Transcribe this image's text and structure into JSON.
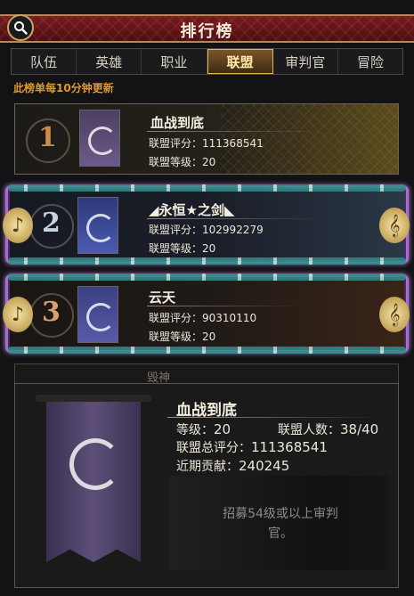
{
  "header": {
    "title": "排行榜",
    "search_icon": "search-icon"
  },
  "tabs": [
    {
      "label": "队伍",
      "active": false
    },
    {
      "label": "英雄",
      "active": false
    },
    {
      "label": "职业",
      "active": false
    },
    {
      "label": "联盟",
      "active": true
    },
    {
      "label": "审判官",
      "active": false
    },
    {
      "label": "冒险",
      "active": false
    }
  ],
  "notice": "此榜单每10分钟更新",
  "rankings": [
    {
      "rank": "1",
      "name": "血战到底",
      "score_label": "联盟评分：",
      "score": "111368541",
      "level_label": "联盟等级：",
      "level": "20"
    },
    {
      "rank": "2",
      "name": "◢永恒★之剑◣",
      "score_label": "联盟评分：",
      "score": "102992279",
      "level_label": "联盟等级：",
      "level": "20"
    },
    {
      "rank": "3",
      "name": "云天",
      "score_label": "联盟评分：",
      "score": "90310110",
      "level_label": "联盟等级：",
      "level": "20"
    },
    {
      "name": "毁神"
    }
  ],
  "detail": {
    "name": "血战到底",
    "level_label": "等级：",
    "level": "20",
    "members_label": "联盟人数：",
    "members": "38/40",
    "total_score_label": "联盟总评分：",
    "total_score": "111368541",
    "contribution_label": "近期贡献：",
    "contribution": "240245",
    "recruit": "招募54级或以上审判官。"
  },
  "colors": {
    "accent": "#e0b45a",
    "notice": "#e09a2a",
    "header": "#6a1519"
  }
}
